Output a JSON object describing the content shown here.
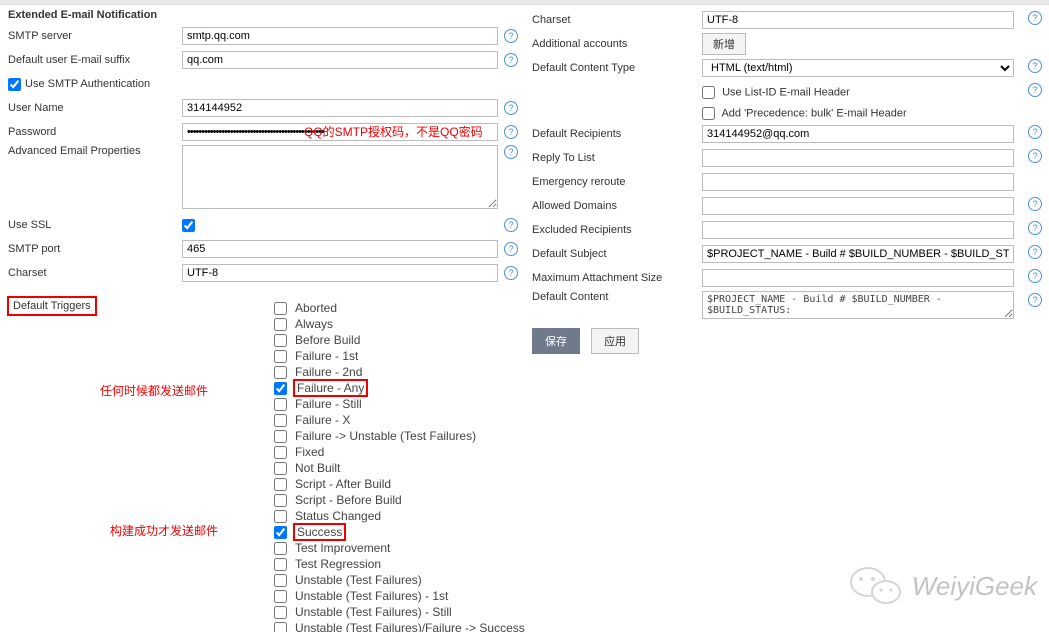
{
  "left": {
    "section_title": "Extended E-mail Notification",
    "smtp_server_label": "SMTP server",
    "smtp_server_value": "smtp.qq.com",
    "suffix_label": "Default user E-mail suffix",
    "suffix_value": "qq.com",
    "use_smtp_auth_label": "Use SMTP Authentication",
    "username_label": "User Name",
    "username_value": "314144952",
    "password_label": "Password",
    "password_value": "••••••••••••••••••••••••••••••••••••••••••••••••",
    "password_annot": "QQ的SMTP授权码，不是QQ密码",
    "adv_props_label": "Advanced Email Properties",
    "use_ssl_label": "Use SSL",
    "smtp_port_label": "SMTP port",
    "smtp_port_value": "465",
    "charset_label": "Charset",
    "charset_value": "UTF-8"
  },
  "right": {
    "charset_label": "Charset",
    "charset_value": "UTF-8",
    "additional_accounts_label": "Additional accounts",
    "add_btn": "新增",
    "default_content_type_label": "Default Content Type",
    "default_content_type_value": "HTML (text/html)",
    "use_listid_label": "Use List-ID E-mail Header",
    "precedence_label": "Add 'Precedence: bulk' E-mail Header",
    "default_recipients_label": "Default Recipients",
    "default_recipients_value": "314144952@qq.com",
    "reply_to_label": "Reply To List",
    "emergency_label": "Emergency reroute",
    "allowed_domains_label": "Allowed Domains",
    "excluded_label": "Excluded Recipients",
    "default_subject_label": "Default Subject",
    "default_subject_value": "$PROJECT_NAME - Build # $BUILD_NUMBER - $BUILD_STATUS!",
    "max_attach_label": "Maximum Attachment Size",
    "default_content_label": "Default Content",
    "default_content_value": "$PROJECT_NAME - Build # $BUILD_NUMBER - $BUILD_STATUS:\n\nCheck console output at $BUILD_URL to view the results.",
    "save_btn": "保存",
    "apply_btn": "应用"
  },
  "triggers": {
    "label": "Default Triggers",
    "annot_any": "任何时候都发送邮件",
    "annot_success": "构建成功才发送邮件",
    "items": [
      {
        "label": "Aborted",
        "checked": false
      },
      {
        "label": "Always",
        "checked": false
      },
      {
        "label": "Before Build",
        "checked": false
      },
      {
        "label": "Failure - 1st",
        "checked": false
      },
      {
        "label": "Failure - 2nd",
        "checked": false
      },
      {
        "label": "Failure - Any",
        "checked": true,
        "boxed": true
      },
      {
        "label": "Failure - Still",
        "checked": false
      },
      {
        "label": "Failure - X",
        "checked": false
      },
      {
        "label": "Failure -> Unstable (Test Failures)",
        "checked": false
      },
      {
        "label": "Fixed",
        "checked": false
      },
      {
        "label": "Not Built",
        "checked": false
      },
      {
        "label": "Script - After Build",
        "checked": false
      },
      {
        "label": "Script - Before Build",
        "checked": false
      },
      {
        "label": "Status Changed",
        "checked": false
      },
      {
        "label": "Success",
        "checked": true,
        "boxed": true
      },
      {
        "label": "Test Improvement",
        "checked": false
      },
      {
        "label": "Test Regression",
        "checked": false
      },
      {
        "label": "Unstable (Test Failures)",
        "checked": false
      },
      {
        "label": "Unstable (Test Failures) - 1st",
        "checked": false
      },
      {
        "label": "Unstable (Test Failures) - Still",
        "checked": false
      },
      {
        "label": "Unstable (Test Failures)/Failure -> Success",
        "checked": false
      }
    ]
  },
  "watermark": "WeiyiGeek"
}
